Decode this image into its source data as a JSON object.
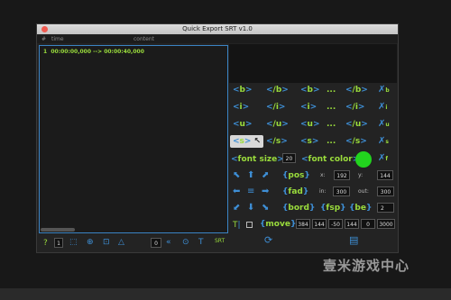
{
  "window": {
    "title": "Quick Export SRT v1.0"
  },
  "columns": {
    "num": "#",
    "time": "time",
    "content": "content"
  },
  "rows": [
    {
      "num": "1",
      "time": "00:00:00,000 --> 00:00:40,000"
    }
  ],
  "tags": {
    "row1": [
      "b",
      "/b",
      "b",
      "...",
      "/b"
    ],
    "row2": [
      "i",
      "/i",
      "i",
      "...",
      "/i"
    ],
    "row3": [
      "u",
      "/u",
      "u",
      "...",
      "/u"
    ],
    "row4": [
      "s",
      "/s",
      "s",
      "...",
      "/s"
    ],
    "clear_subs": [
      "b",
      "i",
      "u",
      "s",
      "f"
    ]
  },
  "font": {
    "size_label": "font size",
    "size_value": "20",
    "color_label": "font color",
    "color_value": "#22d41e"
  },
  "pos": {
    "label": "pos",
    "x_label": "x:",
    "x": "192",
    "y_label": "y:",
    "y": "144"
  },
  "fad": {
    "label": "fad",
    "in_label": "in:",
    "in": "300",
    "out_label": "out:",
    "out": "300"
  },
  "bord": {
    "label": "bord",
    "fsp_label": "fsp",
    "be_label": "be",
    "be_value": "2"
  },
  "move": {
    "label": "move",
    "values": [
      "384",
      "144",
      "-50",
      "144",
      "0",
      "3000"
    ]
  },
  "toolbar": {
    "page_value": "1",
    "zero_value": "0",
    "srt_label": "SRT"
  },
  "colors": {
    "accent_blue": "#3e8fd6",
    "accent_green": "#9adc3c"
  },
  "watermark": "壹米游戏中心"
}
